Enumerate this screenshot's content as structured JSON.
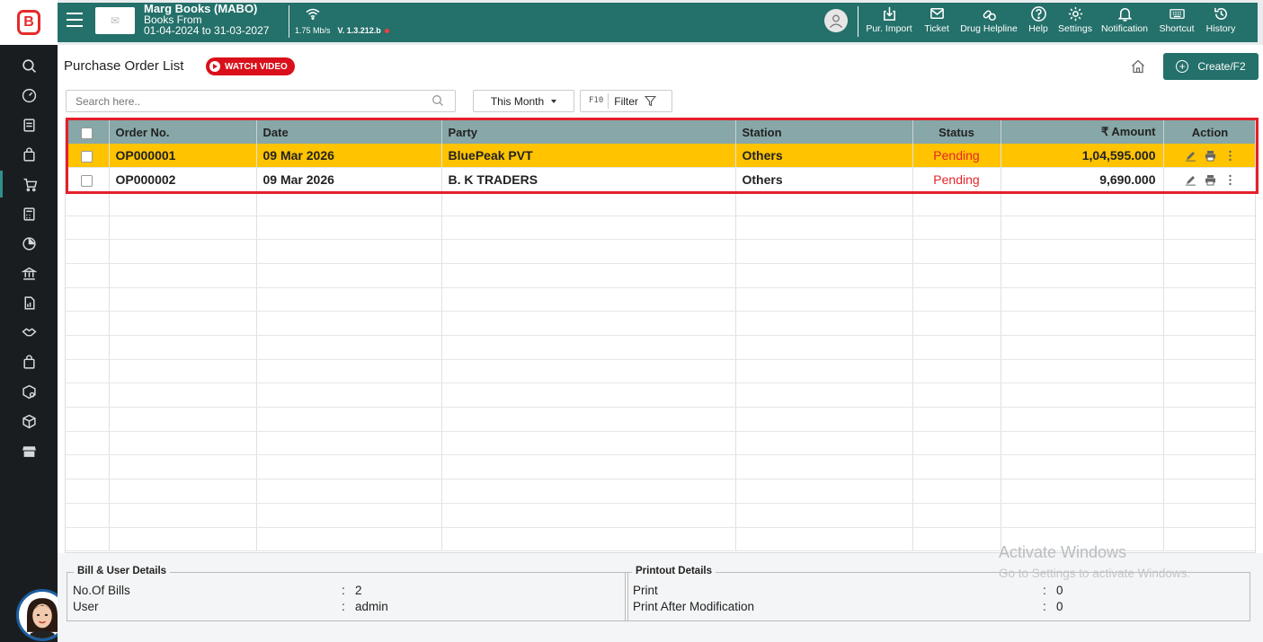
{
  "app": {
    "logo_letter": "B",
    "company_name": "Marg Books (MABO)",
    "books_line1": "Books From",
    "books_line2": "01-04-2024 to 31-03-2027",
    "speed": "1.75 Mb/s",
    "version": "V. 1.3.212.b"
  },
  "header_buttons": [
    {
      "label": "Pur. Import",
      "icon": "import-icon"
    },
    {
      "label": "Ticket",
      "icon": "mail-icon"
    },
    {
      "label": "Drug Helpline",
      "icon": "drug-icon"
    },
    {
      "label": "Help",
      "icon": "help-icon"
    },
    {
      "label": "Settings",
      "icon": "gear-icon"
    },
    {
      "label": "Notification",
      "icon": "bell-icon"
    },
    {
      "label": "Shortcut",
      "icon": "keyboard-icon"
    },
    {
      "label": "History",
      "icon": "history-icon"
    }
  ],
  "page": {
    "title": "Purchase Order List",
    "watch_video": "WATCH VIDEO",
    "create_label": "Create/F2"
  },
  "toolbar": {
    "search_placeholder": "Search here..",
    "period": "This Month",
    "filter_key": "F10",
    "filter_label": "Filter"
  },
  "table": {
    "columns": [
      "Order No.",
      "Date",
      "Party",
      "Station",
      "Status",
      "₹ Amount",
      "Action"
    ],
    "rows": [
      {
        "order_no": "OP000001",
        "date": "09 Mar 2026",
        "party": "BluePeak PVT",
        "station": "Others",
        "status": "Pending",
        "amount": "1,04,595.000",
        "selected": true
      },
      {
        "order_no": "OP000002",
        "date": "09 Mar 2026",
        "party": "B. K TRADERS",
        "station": "Others",
        "status": "Pending",
        "amount": "9,690.000",
        "selected": false
      }
    ]
  },
  "footer": {
    "bill_title": "Bill & User Details",
    "bills_label": "No.Of Bills",
    "bills_value": "2",
    "user_label": "User",
    "user_value": "admin",
    "print_title": "Printout Details",
    "print_label": "Print",
    "print_value": "0",
    "print_mod_label": "Print After Modification",
    "print_mod_value": "0"
  },
  "watermark": {
    "line1": "Activate Windows",
    "line2": "Go to Settings to activate Windows."
  },
  "colors": {
    "header": "#24706a",
    "table_header": "#87a7a8",
    "selected_row": "#ffc300",
    "status_pending": "#e3262a",
    "highlight_border": "#e4202a"
  }
}
